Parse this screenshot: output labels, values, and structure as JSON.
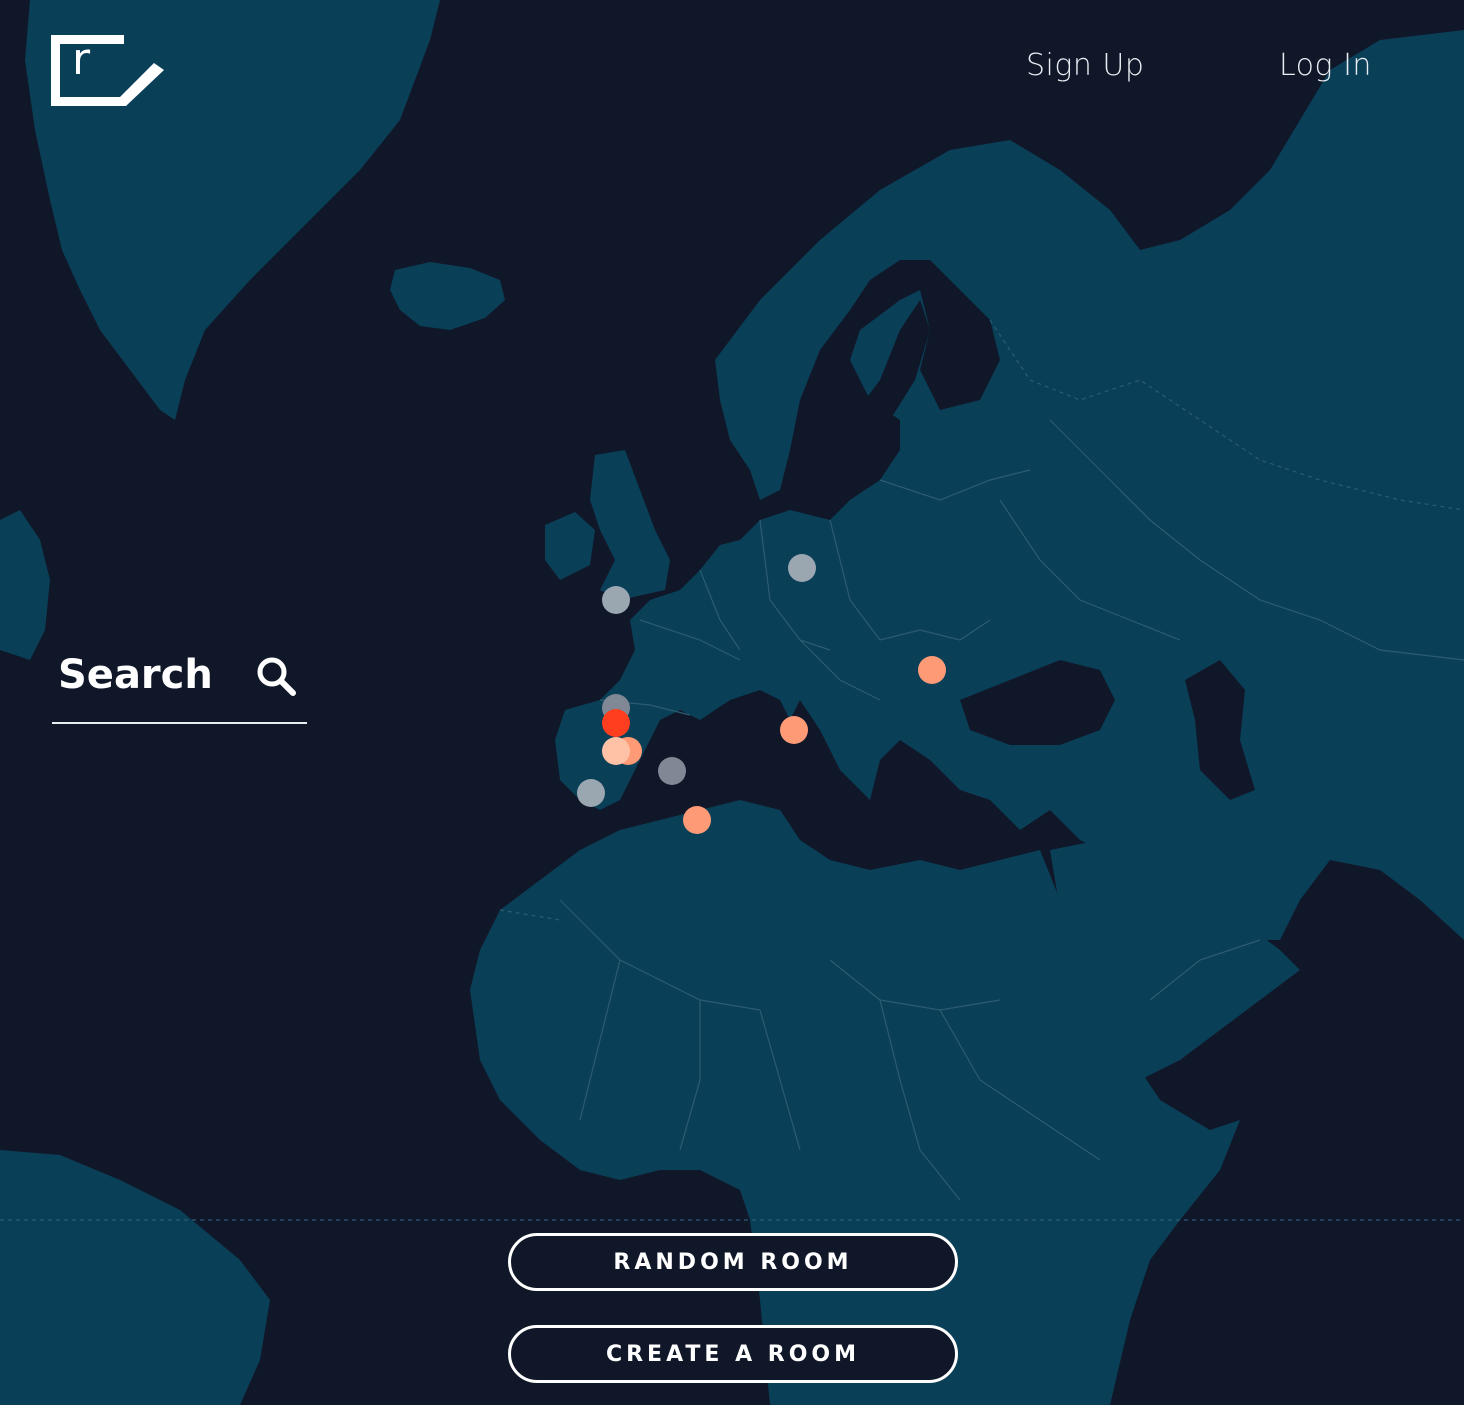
{
  "header": {
    "logo_letter": "r",
    "signup_label": "Sign Up",
    "login_label": "Log In"
  },
  "search": {
    "label": "Search",
    "icon": "search-icon"
  },
  "actions": {
    "random_room_label": "RANDOM ROOM",
    "create_room_label": "CREATE A ROOM"
  },
  "colors": {
    "ocean": "#101728",
    "land": "#0a3f58",
    "border": "#2c5c73",
    "text": "#ffffff",
    "marker_gray": "#9aa6b0",
    "marker_dark_gray": "#7f8894",
    "marker_peach": "#ff9a76",
    "marker_light_peach": "#ffc2a6",
    "marker_red": "#ff3d1f"
  },
  "room_markers": [
    {
      "id": "m1",
      "color": "#9aa6b0"
    },
    {
      "id": "m2",
      "color": "#9aa6b0"
    },
    {
      "id": "m3",
      "color": "#ff9a76"
    },
    {
      "id": "m4",
      "color": "#ff9a76"
    },
    {
      "id": "m5",
      "color": "#7f8894"
    },
    {
      "id": "m6",
      "color": "#ff3d1f"
    },
    {
      "id": "m7",
      "color": "#ff9a76"
    },
    {
      "id": "m8",
      "color": "#ffc2a6"
    },
    {
      "id": "m9",
      "color": "#7f8894"
    },
    {
      "id": "m10",
      "color": "#9aa6b0"
    },
    {
      "id": "m11",
      "color": "#ff9a76"
    }
  ]
}
